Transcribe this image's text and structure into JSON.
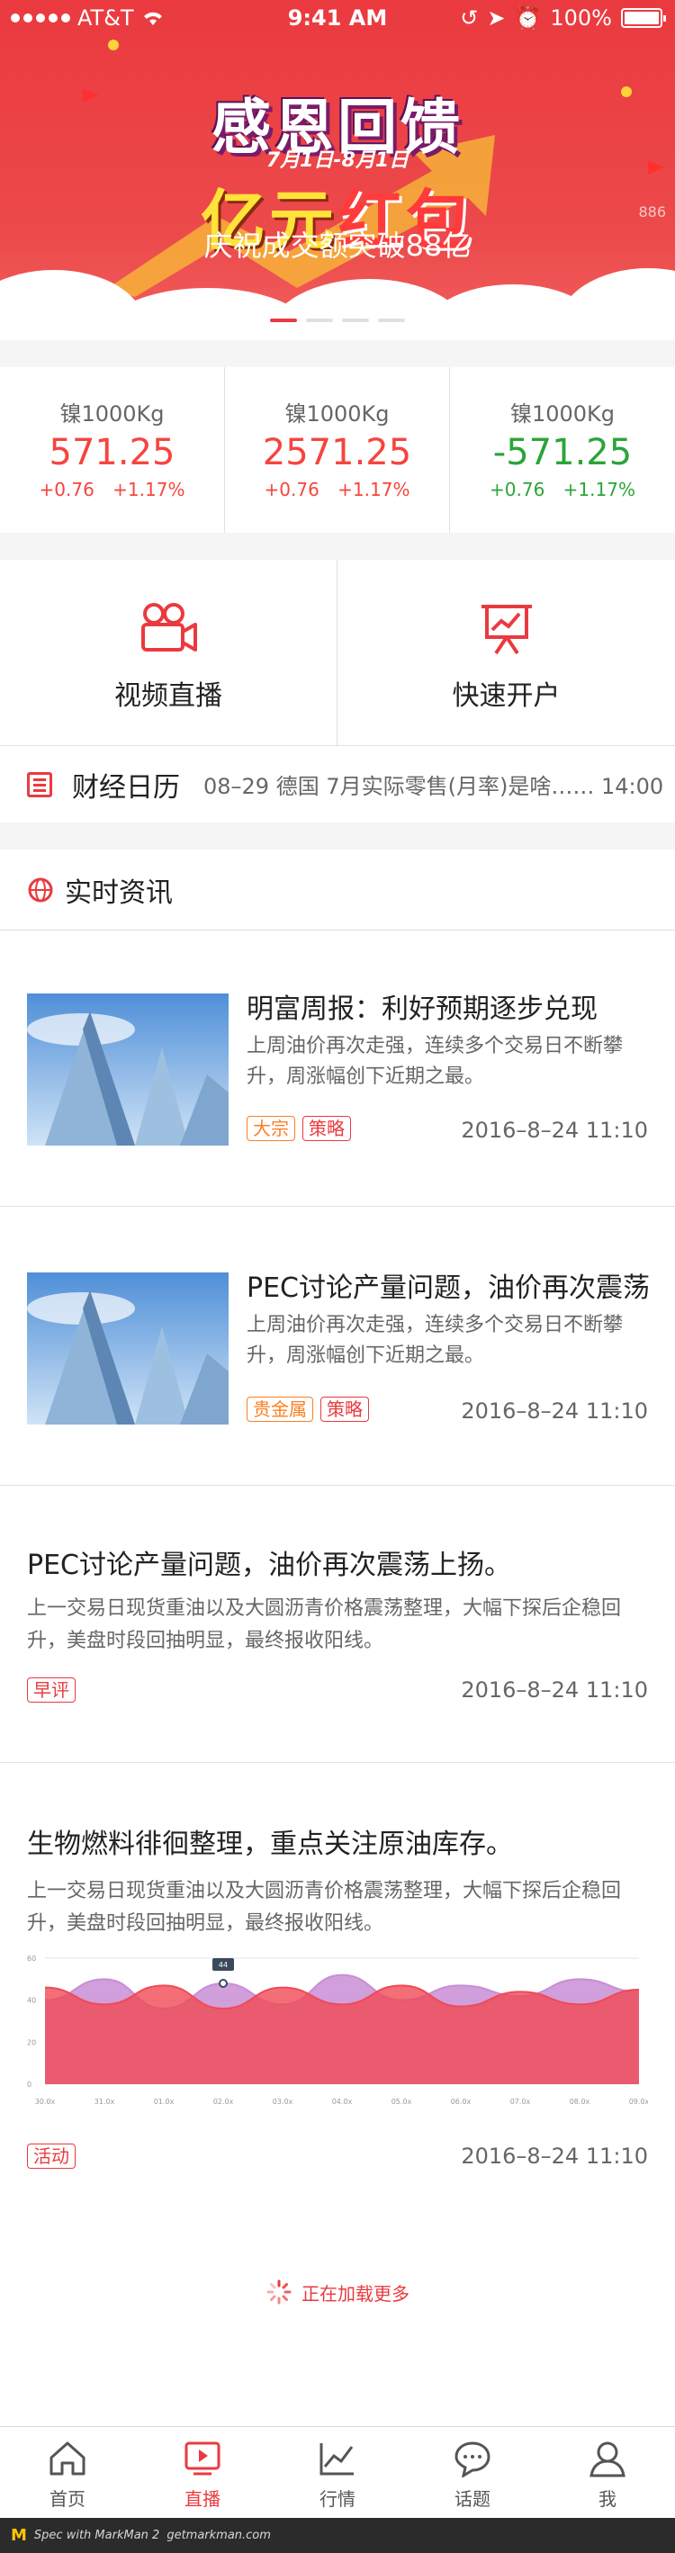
{
  "status_bar": {
    "carrier": "AT&T",
    "time": "9:41 AM",
    "battery": "100%"
  },
  "banner": {
    "title": "感恩回馈",
    "date": "7月1日-8月1日",
    "slogan_part1": "亿元",
    "slogan_part2": "红包",
    "subtitle": "庆祝成交额突破88亿",
    "ghost_text": "886"
  },
  "tickers": [
    {
      "name": "镍1000Kg",
      "price": "571.25",
      "change": "+0.76",
      "percent": "+1.17%",
      "direction": "up"
    },
    {
      "name": "镍1000Kg",
      "price": "2571.25",
      "change": "+0.76",
      "percent": "+1.17%",
      "direction": "up"
    },
    {
      "name": "镍1000Kg",
      "price": "-571.25",
      "change": "+0.76",
      "percent": "+1.17%",
      "direction": "down"
    }
  ],
  "features": [
    {
      "label": "视频直播",
      "icon": "video-camera-icon"
    },
    {
      "label": "快速开户",
      "icon": "presentation-board-icon"
    }
  ],
  "calendar": {
    "title": "财经日历",
    "text": "08–29  德国 7月实际零售(月率)是啥……  14:00"
  },
  "news_section": {
    "title": "实时资讯",
    "items": [
      {
        "title": "明富周报：利好预期逐步兑现",
        "summary": "上周油价再次走强，连续多个交易日不断攀升，周涨幅创下近期之最。",
        "tags": [
          "大宗",
          "策略"
        ],
        "date": "2016–8–24  11:10"
      },
      {
        "title": "PEC讨论产量问题，油价再次震荡",
        "summary": "上周油价再次走强，连续多个交易日不断攀升，周涨幅创下近期之最。",
        "tags": [
          "贵金属",
          "策略"
        ],
        "date": "2016–8–24  11:10"
      }
    ],
    "articles": [
      {
        "title": "PEC讨论产量问题，油价再次震荡上扬。",
        "summary": "上一交易日现货重油以及大圆沥青价格震荡整理，大幅下探后企稳回升，美盘时段回抽明显，最终报收阳线。",
        "tag": "早评",
        "date": "2016–8–24  11:10"
      },
      {
        "title": "生物燃料徘徊整理，重点关注原油库存。",
        "summary": "上一交易日现货重油以及大圆沥青价格震荡整理，大幅下探后企稳回升，美盘时段回抽明显，最终报收阳线。",
        "tag": "活动",
        "date": "2016–8–24  11:10"
      }
    ]
  },
  "chart_data": {
    "type": "area",
    "title": "",
    "xlabel": "",
    "ylabel": "",
    "ylim": [
      0,
      60
    ],
    "yticks": [
      "0",
      "20",
      "40",
      "60"
    ],
    "x": [
      "30.0x",
      "31.0x",
      "01.0x",
      "02.0x",
      "03.0x",
      "04.0x",
      "05.0x",
      "06.0x",
      "07.0x",
      "08.0x",
      "09.0x"
    ],
    "tooltip": "44",
    "series": [
      {
        "color": "#c88ed6",
        "values": [
          40,
          50,
          36,
          48,
          38,
          52,
          40,
          47,
          42,
          50,
          44
        ]
      },
      {
        "color": "#f04a55",
        "values": [
          46,
          38,
          47,
          36,
          46,
          38,
          47,
          37,
          44,
          38,
          45
        ]
      }
    ]
  },
  "loading_text": "正在加载更多",
  "tabbar": [
    {
      "label": "首页",
      "icon": "home-icon",
      "active": false
    },
    {
      "label": "直播",
      "icon": "play-icon",
      "active": true
    },
    {
      "label": "行情",
      "icon": "chart-line-icon",
      "active": false
    },
    {
      "label": "话题",
      "icon": "chat-bubble-icon",
      "active": false
    },
    {
      "label": "我",
      "icon": "user-icon",
      "active": false
    }
  ],
  "footer": {
    "brand": "M",
    "text": "Spec with MarkMan 2",
    "url": "getmarkman.com"
  },
  "colors": {
    "accent": "#ea3a3f",
    "up": "#f5453f",
    "down": "#2ca43a",
    "orange": "#fb7f24",
    "gap": "#f5f5f5",
    "divider": "#e0e0e0"
  }
}
